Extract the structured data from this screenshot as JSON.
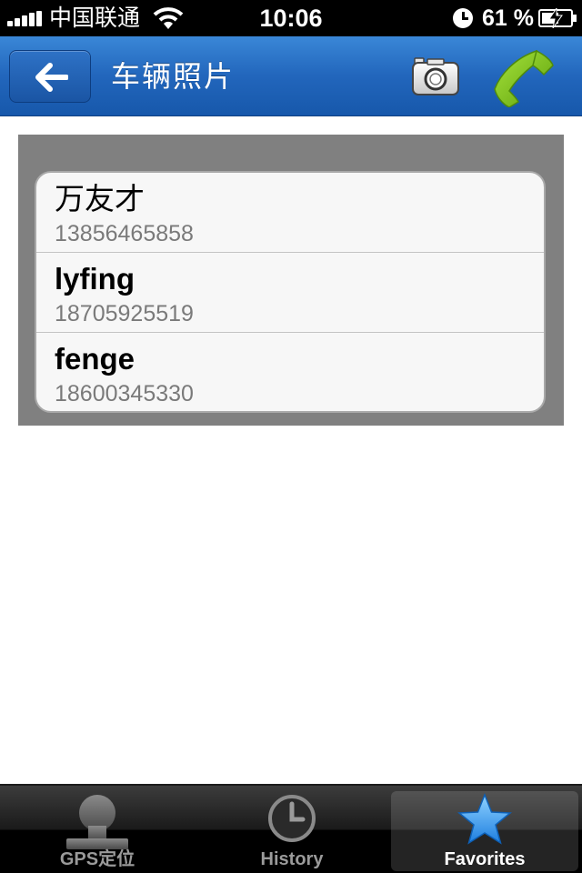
{
  "status_bar": {
    "carrier": "中国联通",
    "time": "10:06",
    "battery_percent": "61 %",
    "battery_level": 0.61
  },
  "nav": {
    "title": "车辆照片",
    "back_icon": "arrow-left-icon",
    "camera_icon": "camera-icon",
    "phone_icon": "phone-icon"
  },
  "contacts": [
    {
      "name": "万友才",
      "phone": "13856465858"
    },
    {
      "name": "lyfing",
      "phone": "18705925519"
    },
    {
      "name": "fenge",
      "phone": "18600345330"
    }
  ],
  "tabs": [
    {
      "label": "GPS定位",
      "icon": "person-pin-icon",
      "active": false
    },
    {
      "label": "History",
      "icon": "clock-icon",
      "active": false
    },
    {
      "label": "Favorites",
      "icon": "star-icon",
      "active": true
    }
  ],
  "colors": {
    "nav_blue": "#2266bc",
    "panel_gray": "#808080",
    "phone_green": "#7cc414",
    "star_blue": "#3aa0f0"
  }
}
